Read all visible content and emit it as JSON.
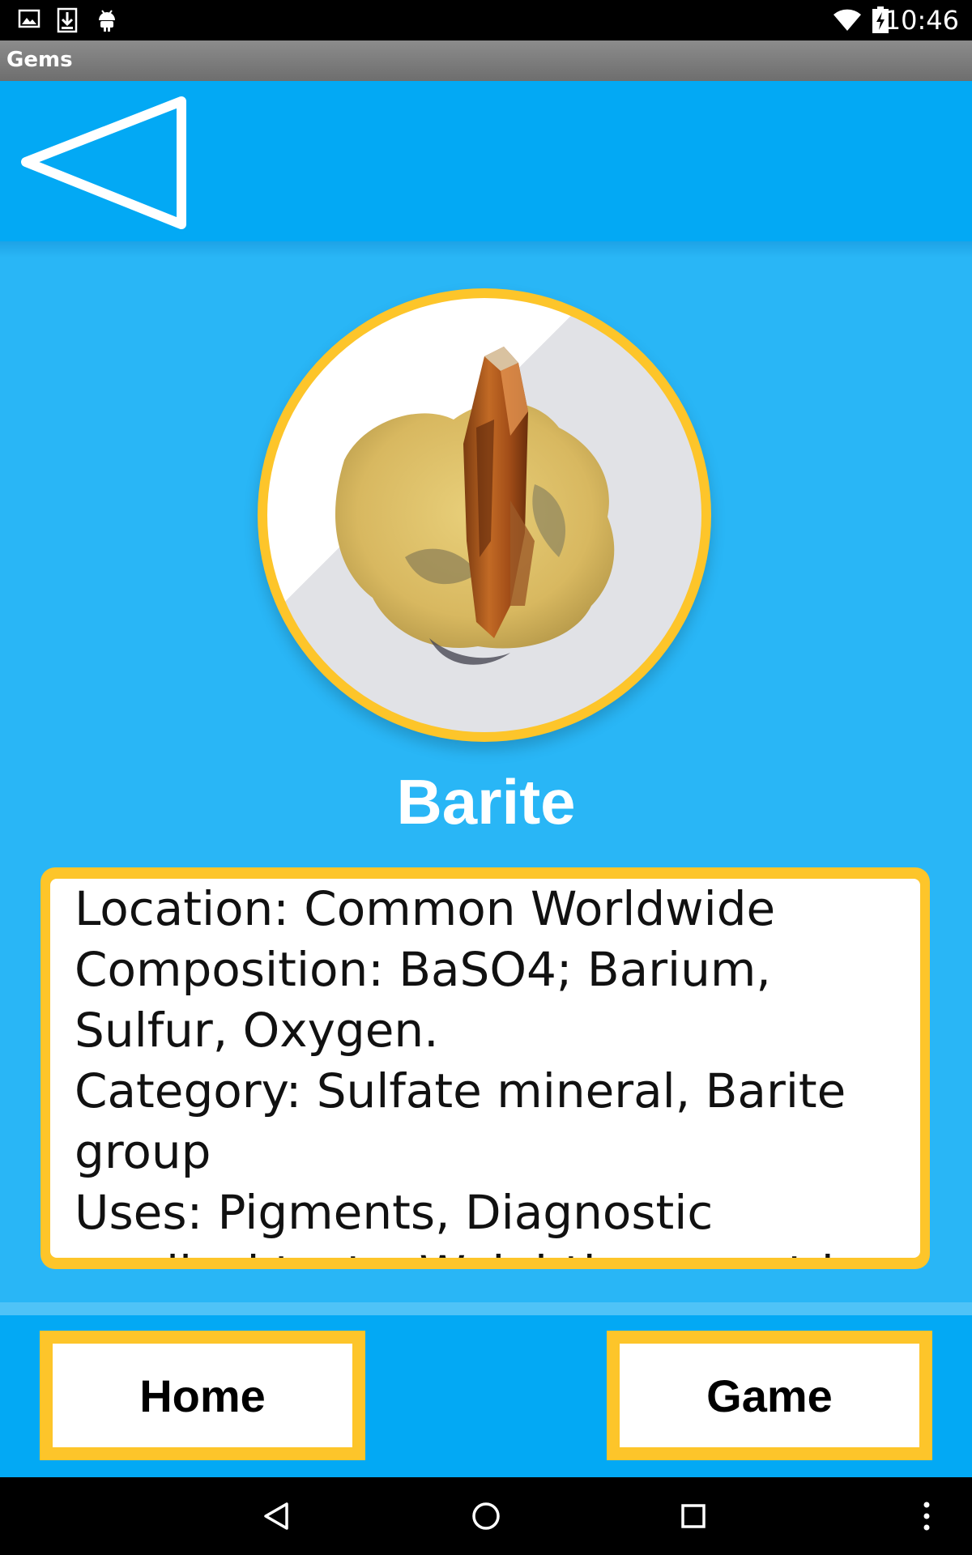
{
  "status_bar": {
    "time": "10:46",
    "left_icons": [
      "image-icon",
      "download-icon",
      "android-icon"
    ],
    "right_icons": [
      "wifi-icon",
      "battery-charging-icon"
    ]
  },
  "app": {
    "title": "Gems"
  },
  "header": {
    "back_icon": "back-triangle-icon"
  },
  "gem": {
    "name": "Barite",
    "image": "barite-crystal-photo",
    "details": [
      "Location: Common Worldwide",
      "Composition: BaSO4; Barium, Sulfur, Oxygen.",
      "Category: Sulfate mineral, Barite group",
      "Uses: Pigments, Diagnostic medical tests, Weighting agent in drilling"
    ]
  },
  "buttons": {
    "home_label": "Home",
    "game_label": "Game"
  },
  "system_nav": [
    "back-icon",
    "home-circle-icon",
    "recents-icon",
    "overflow-menu-icon"
  ],
  "colors": {
    "background": "#29b6f6",
    "header": "#03a9f4",
    "accent_border": "#fdc52a",
    "text_on_blue": "#ffffff"
  }
}
